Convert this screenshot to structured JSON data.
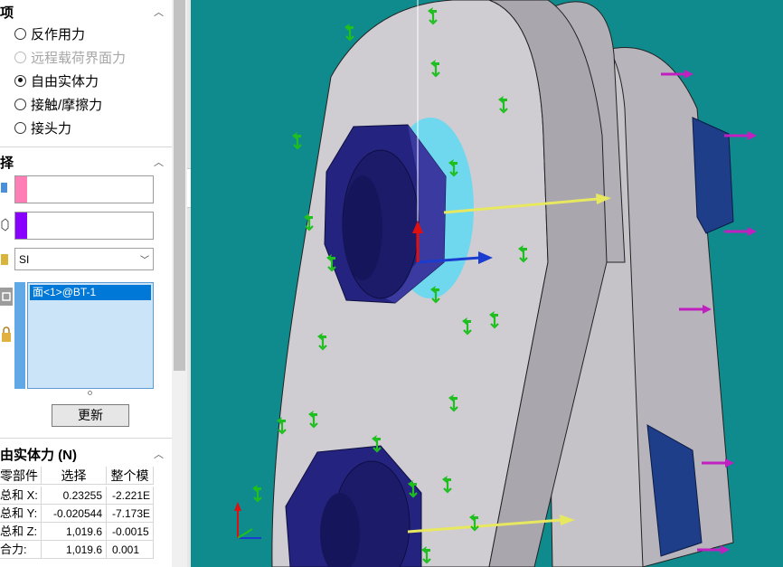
{
  "options_section": {
    "title": "项",
    "items": [
      {
        "label": "反作用力",
        "state": "unselected"
      },
      {
        "label": "远程载荷界面力",
        "state": "disabled"
      },
      {
        "label": "自由实体力",
        "state": "selected"
      },
      {
        "label": "接触/摩擦力",
        "state": "unselected"
      },
      {
        "label": "接头力",
        "state": "unselected"
      }
    ]
  },
  "selection_section": {
    "title": "择",
    "box1_color": "#ff7eb6",
    "box2_color": "#8a00ff",
    "units_value": "SI",
    "list_items": [
      "面<1>@BT-1"
    ],
    "update_label": "更新"
  },
  "results_section": {
    "title": "由实体力 (N)",
    "headers": [
      "零部件",
      "选择",
      "整个模"
    ],
    "rows": [
      {
        "label": "总和 X:",
        "selection": "0.23255",
        "whole": "-2.221E"
      },
      {
        "label": "总和 Y:",
        "selection": "-0.020544",
        "whole": "-7.173E"
      },
      {
        "label": "总和 Z:",
        "selection": "1,019.6",
        "whole": "-0.0015"
      },
      {
        "label": "合力:",
        "selection": "1,019.6",
        "whole": "0.001"
      }
    ]
  },
  "viewport": {
    "background": "#0f8b8d",
    "part_color": "#c8c6cc",
    "nut_color": "#2a2a8a",
    "force_arrow_color": "#1fbf1f",
    "load_arrow_color": "#c020c0",
    "resultant_color": "#e8e860"
  }
}
